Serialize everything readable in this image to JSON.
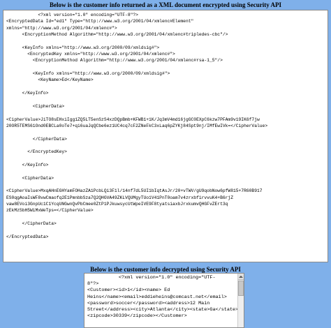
{
  "encrypted_section": {
    "heading": "Below is the customer info returned as a XML document encrypted using Security API",
    "lines": [
      "            <?xml version=\"1.0\" encoding=\"UTF-8\"?>",
      "<EncryptedData Id=\"ed1\" Type=\"http://www.w3.org/2001/04/xmlenc#Element\"",
      "xmlns=\"http://www.w3.org/2001/04/xmlenc#\">",
      "      <EncryptionMethod Algorithm=\"http://www.w3.org/2001/04/xmlenc#tripledes-cbc\"/>",
      "",
      "      <KeyInfo xmlns=\"http://www.w3.org/2000/09/xmldsig#\">",
      "        <EncryptedKey xmlns=\"http://www.w3.org/2001/04/xmlenc#\">",
      "          <EncryptionMethod Algorithm=\"http://www.w3.org/2001/04/xmlenc#rsa-1_5\"/>",
      "",
      "          <KeyInfo xmlns=\"http://www.w3.org/2000/09/xmldsig#\">",
      "            <KeyName>Ed</KeyName>",
      "",
      "      </KeyInfo>",
      "",
      "          <CipherData>",
      "",
      "<CipherValue>JiTO8sEHxiIgg1ZQ5LT5enSzS4xzDQpBmb+KFWB1+1K/Jq3mV4md16jgGC0EXpC6kzw7PFAm9v19IK6f7jw",
      "20OR5TEMS61Ond0EBCLa0oTe7+qi6uaJqQCbe6ez1UC4cq7cF2ZNeFkC3xLaq6pZYKj84Spt9nj/IMfEwIVk=</CipherValue>",
      "",
      "          </CipherData>",
      "",
      "        </EncryptedKey>",
      "",
      "      </KeyInfo>",
      "",
      "      <CipherData>",
      "",
      "<CipherValue>MxqAHnEGHYamFOHazZA1PcbLQi3F1l/14nf7dL5UI1bIqtAsJr/20+vTWV/gU9qobNow6pfW815+7R60B917",
      "ES0qgAoaIsWF8vwCmaofq2E1PmnbbSza7Q2QHGVA49ZKLVQUMgyTUo1V41PnT0oam7v4zrxbfirvvuK4+B6rjZ",
      "vaw8EVoi3GnpUc1C1YcqUNGwnQvPbCmee0ZtP1PJkuwsycUtWpeIVE9F8tyatsiaxbJrxkumvQHGFvZErt3q",
      "zEkMzSbH5WiMxWeTps=</CipherValue>",
      "",
      "      </CipherData>",
      "",
      "</EncryptedData>"
    ]
  },
  "decrypted_section": {
    "heading": "Below is the customer info decrypted using Security API",
    "lines": [
      "           <?xml version=\"1.0\" encoding=\"UTF-",
      "8\"?>",
      "<Customer><id>1</id><name> Ed",
      "Heins</name><email>eddieheins@comcast.net</email>",
      "<password>soccer</password><address>12 Main",
      "Street</address><city>Atlanta</city><state>Ga</state>",
      "<zipcode>30339</zipcode></Customer>"
    ]
  }
}
